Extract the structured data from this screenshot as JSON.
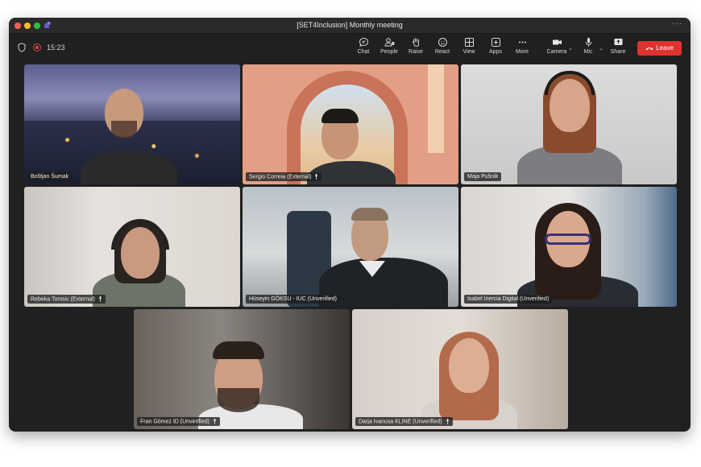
{
  "window": {
    "title": "[SET4Inclusion] Monthly meeting"
  },
  "toolbar": {
    "timer": "15:23",
    "chat": "Chat",
    "people": "People",
    "raise": "Raise",
    "react": "React",
    "view": "View",
    "apps": "Apps",
    "more": "More",
    "camera": "Camera",
    "mic": "Mic",
    "share": "Share",
    "leave": "Leave"
  },
  "participants": [
    {
      "name": "Boštjan Šumak"
    },
    {
      "name": "Sergio Correia (External)"
    },
    {
      "name": "Maja Pušnik"
    },
    {
      "name": "Rebeka Tomsic (External)"
    },
    {
      "name": "Hüseyin GÖKSU - IUC (Unverified)"
    },
    {
      "name": "Isabel Inercia Digital (Unverified)"
    },
    {
      "name": "Fran Gómez ID (Unverified)"
    },
    {
      "name": "Darja Ivanusa KLINE (Unverified)"
    }
  ],
  "colors": {
    "leave": "#e0322f",
    "recording": "#e34848",
    "window_bg": "#202020"
  }
}
